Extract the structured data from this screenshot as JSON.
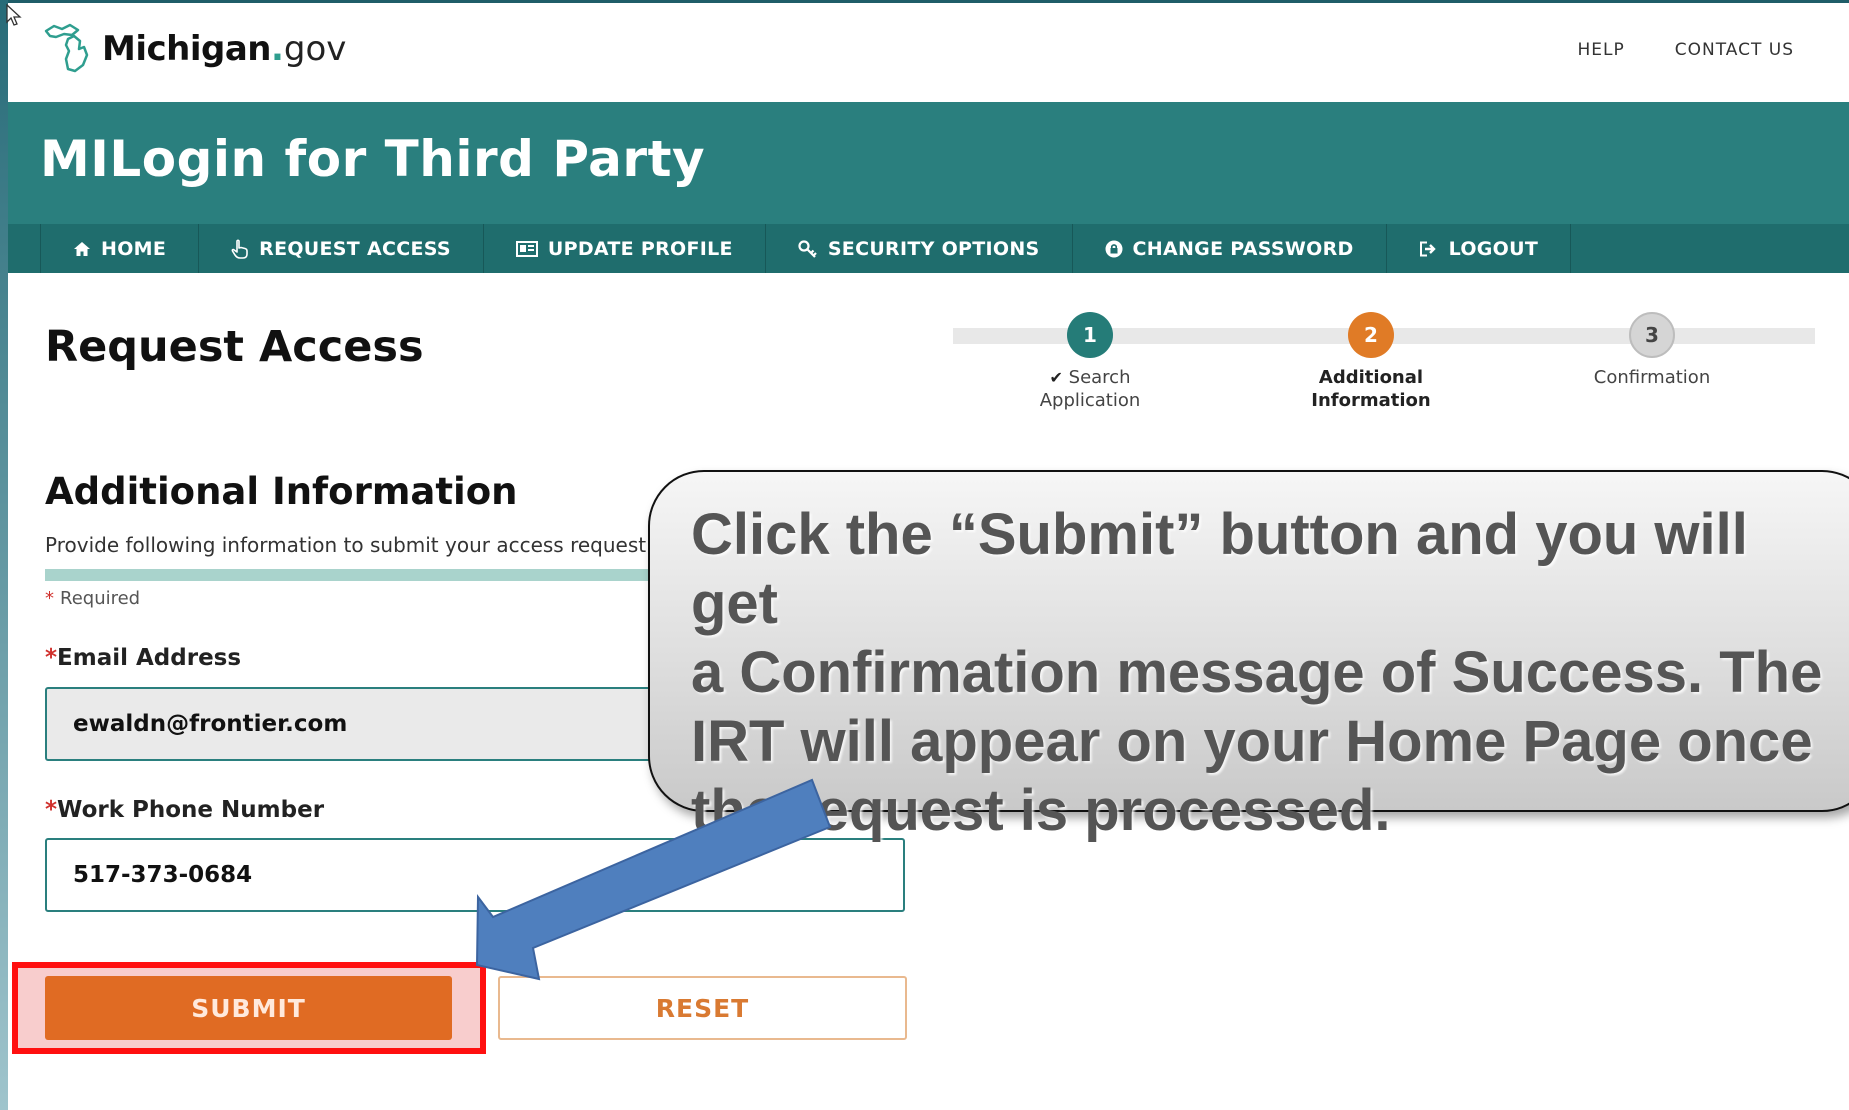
{
  "header": {
    "logo": {
      "name": "Michigan",
      "dot": ".",
      "suffix": "gov"
    },
    "links": [
      "HELP",
      "CONTACT US"
    ]
  },
  "banner": {
    "title": "MILogin for Third Party"
  },
  "nav": {
    "items": [
      {
        "label": "HOME",
        "icon": "home-icon"
      },
      {
        "label": "REQUEST ACCESS",
        "icon": "hand-pointer-icon"
      },
      {
        "label": "UPDATE PROFILE",
        "icon": "id-card-icon"
      },
      {
        "label": "SECURITY OPTIONS",
        "icon": "key-icon"
      },
      {
        "label": "CHANGE PASSWORD",
        "icon": "lock-icon"
      },
      {
        "label": "LOGOUT",
        "icon": "sign-out-icon"
      }
    ]
  },
  "page": {
    "title": "Request Access",
    "section_title": "Additional Information",
    "section_sub": "Provide following information to submit your access request",
    "required_note": "Required",
    "required_star": "*"
  },
  "stepper": {
    "steps": [
      {
        "number": "1",
        "label_line1": "Search",
        "label_line2": "Application",
        "state": "complete",
        "color": "#257c78"
      },
      {
        "number": "2",
        "label_line1": "Additional",
        "label_line2": "Information",
        "state": "current",
        "color": "#e07b26"
      },
      {
        "number": "3",
        "label_line1": "Confirmation",
        "label_line2": "",
        "state": "upcoming",
        "color": "#d5d5d5"
      }
    ],
    "check_mark": "✔"
  },
  "form": {
    "email": {
      "label": "Email Address",
      "value": "ewaldn@frontier.com"
    },
    "phone": {
      "label": "Work Phone Number",
      "value": "517-373-0684"
    },
    "submit_label": "SUBMIT",
    "reset_label": "RESET"
  },
  "callout": {
    "lines": [
      "Click the “Submit” button and you will get",
      "a Confirmation message of Success.  The",
      "IRT will appear on your Home Page once",
      "the request is processed."
    ]
  },
  "colors": {
    "brand_teal": "#2a7f7e",
    "nav_teal": "#1f6d6d",
    "submit_orange": "#e06b23",
    "highlight_red": "#ff1010",
    "arrow_blue": "#4f7fbe"
  }
}
